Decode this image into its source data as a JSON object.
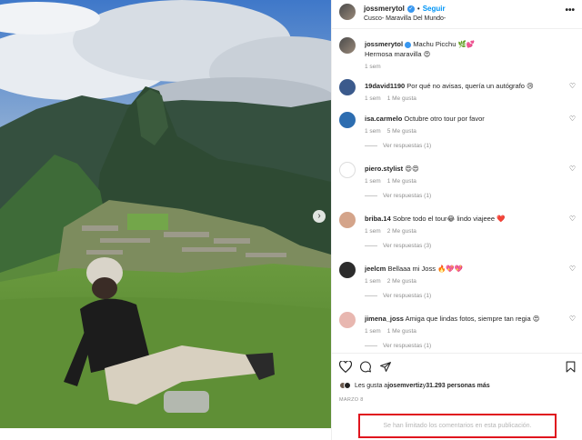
{
  "post": {
    "author": "jossmerytol",
    "follow_label": "Seguir",
    "separator": "•",
    "location": "Cusco- Maravilla Del Mundo-",
    "more_label": "•••"
  },
  "caption": {
    "user": "jossmerytol",
    "text_line1": "Machu Picchu 🌿💕",
    "text_line2": "Hermosa maravilla 😍",
    "time": "1 sem"
  },
  "comments": [
    {
      "user": "19david1190",
      "text": "Por qué no avisas, quería un autógrafo 😢",
      "time": "1 sem",
      "likes": "1 Me gusta",
      "replies": ""
    },
    {
      "user": "isa.carmelo",
      "text": "Octubre otro tour por favor",
      "time": "1 sem",
      "likes": "5 Me gusta",
      "replies": "Ver respuestas (1)"
    },
    {
      "user": "piero.stylist",
      "text": "😍😍",
      "time": "1 sem",
      "likes": "1 Me gusta",
      "replies": "Ver respuestas (1)"
    },
    {
      "user": "briba.14",
      "text": "Sobre todo el tour😂 lindo viajeee ❤️",
      "time": "1 sem",
      "likes": "2 Me gusta",
      "replies": "Ver respuestas (3)"
    },
    {
      "user": "jeelcm",
      "text": "Bellaaa mi Joss 🔥💖💖",
      "time": "1 sem",
      "likes": "2 Me gusta",
      "replies": "Ver respuestas (1)"
    },
    {
      "user": "jimena_joss",
      "text": "Amiga que lindas fotos, siempre tan regia 😍",
      "time": "1 sem",
      "likes": "1 Me gusta",
      "replies": "Ver respuestas (1)"
    }
  ],
  "likes_line": {
    "prefix": "Les gusta a ",
    "user": "josemvertiz",
    "middle": " y ",
    "count": "31.293 personas más"
  },
  "date": "MARZO 8",
  "comments_limited": "Se han limitado los comentarios en esta publicación.",
  "icons": {
    "like": "heart-icon",
    "comment": "comment-icon",
    "share": "paper-plane-icon",
    "save": "bookmark-icon",
    "next": "chevron-right-icon"
  }
}
